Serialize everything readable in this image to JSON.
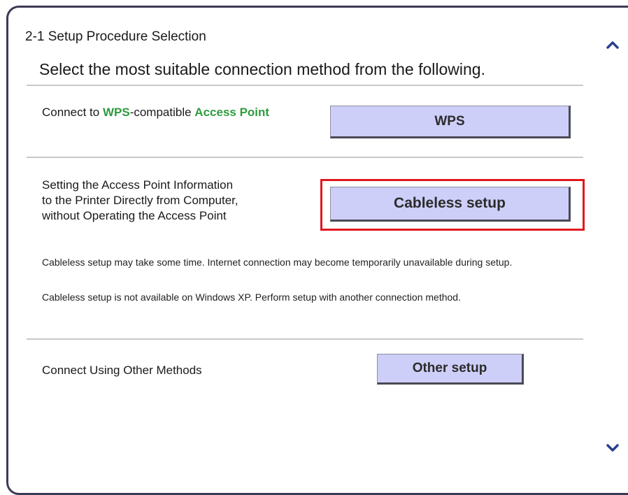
{
  "header": {
    "step_title": "2-1 Setup Procedure Selection",
    "subtitle": "Select the most suitable connection method from the following."
  },
  "options": {
    "wps": {
      "label_pre": "Connect to ",
      "label_wps": "WPS",
      "label_mid": "-compatible ",
      "label_ap": "Access Point",
      "button": "WPS"
    },
    "cableless": {
      "label_line1": "Setting the Access Point Information",
      "label_line2": "to the Printer Directly from Computer,",
      "label_line3": "without Operating the Access Point",
      "button": "Cableless setup",
      "note1": "Cableless setup may take some time. Internet connection may become temporarily unavailable during setup.",
      "note2": "Cableless setup is not available on Windows XP. Perform setup with another connection method."
    },
    "other": {
      "label": "Connect Using Other Methods",
      "button": "Other setup"
    }
  },
  "icons": {
    "scroll_up": "chevron-up-icon",
    "scroll_down": "chevron-down-icon"
  },
  "colors": {
    "accent_green": "#2e9b3e",
    "button_fill": "#cdcff8",
    "highlight_red": "#e0191f",
    "frame_border": "#3b3a55"
  }
}
